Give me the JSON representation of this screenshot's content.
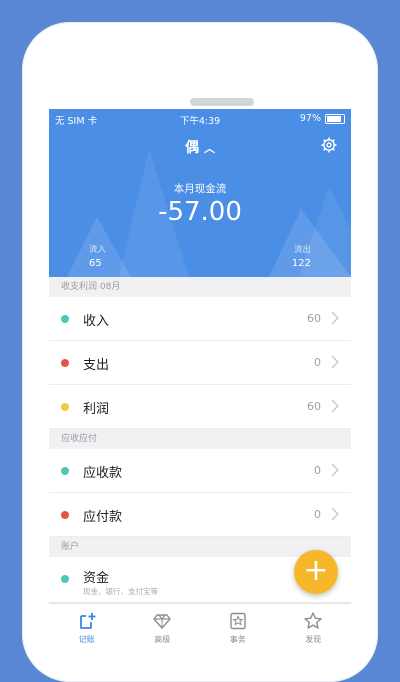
{
  "status": {
    "carrier": "无 SIM 卡",
    "time": "下午4:39",
    "battery": "97%"
  },
  "header": {
    "title": "偶",
    "cash_label": "本月现金流",
    "cash_value": "-57.00",
    "inflow_label": "流入",
    "inflow_value": "65",
    "outflow_label": "流出",
    "outflow_value": "122"
  },
  "sections": {
    "profit": "收支利润 08月",
    "receivable": "应收应付",
    "accounts": "账户"
  },
  "rows": [
    {
      "name": "收入",
      "value": "60",
      "color": "#4cc6b5"
    },
    {
      "name": "支出",
      "value": "0",
      "color": "#e2574c"
    },
    {
      "name": "利润",
      "value": "60",
      "color": "#f2c744"
    },
    {
      "name": "应收款",
      "value": "0",
      "color": "#4cc6b5"
    },
    {
      "name": "应付款",
      "value": "0",
      "color": "#e2574c"
    }
  ],
  "account": {
    "name": "资金",
    "sub": "现金、银行、支付宝等",
    "color": "#4cc6b5"
  },
  "fab": {
    "label": "+"
  },
  "tabs": [
    {
      "label": "记账",
      "icon": "ledger-icon"
    },
    {
      "label": "高级",
      "icon": "diamond-icon"
    },
    {
      "label": "事务",
      "icon": "task-star-icon"
    },
    {
      "label": "发现",
      "icon": "star-icon"
    }
  ],
  "colors": {
    "header": "#4a8ee6",
    "accent": "#3a86e6",
    "fab": "#f7b72b",
    "background": "#5a86d6"
  }
}
